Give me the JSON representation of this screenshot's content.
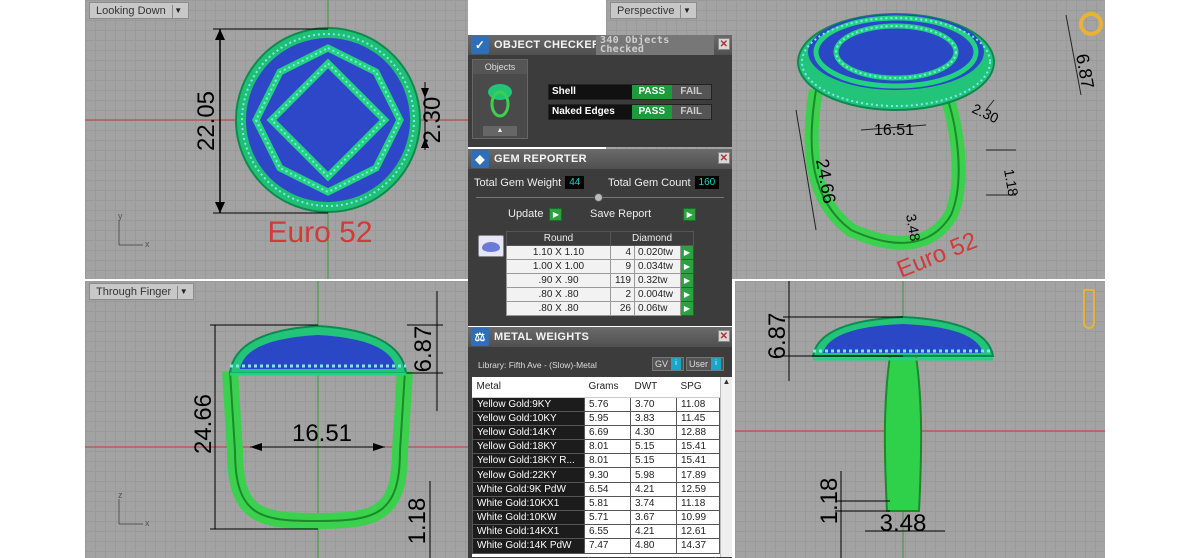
{
  "viewports": {
    "top_left": {
      "label": "Looking Down",
      "dims": [
        "22.05",
        "2.30"
      ],
      "ring_size": "Euro 52",
      "axes": [
        "y",
        "x"
      ]
    },
    "top_right": {
      "label": "Perspective",
      "dims": [
        "6.87",
        "2.30",
        "16.51",
        "24.66",
        "1.18",
        "3.48"
      ],
      "ring_size": "Euro 52"
    },
    "bottom_left": {
      "label": "Through Finger",
      "dims": [
        "6.87",
        "24.66",
        "16.51",
        "1.18"
      ],
      "axes": [
        "z",
        "x"
      ]
    },
    "bottom_right": {
      "dims": [
        "6.87",
        "1.18",
        "3.48"
      ]
    }
  },
  "object_checker": {
    "title": "OBJECT CHECKER",
    "count_text": "340 Objects Checked",
    "objects_label": "Objects",
    "checks": [
      {
        "label": "Shell",
        "pass": "PASS",
        "fail": "FAIL"
      },
      {
        "label": "Naked Edges",
        "pass": "PASS",
        "fail": "FAIL"
      }
    ]
  },
  "gem_reporter": {
    "title": "GEM REPORTER",
    "total_weight_label": "Total Gem Weight",
    "total_weight": "44",
    "total_count_label": "Total Gem Count",
    "total_count": "160",
    "update_label": "Update",
    "save_label": "Save Report",
    "headers": [
      "Round",
      "Diamond"
    ],
    "rows": [
      {
        "size": "1.10 X 1.10",
        "count": "4",
        "weight": "0.020tw"
      },
      {
        "size": "1.00 X 1.00",
        "count": "9",
        "weight": "0.034tw"
      },
      {
        "size": ".90 X .90",
        "count": "119",
        "weight": "0.32tw"
      },
      {
        "size": ".80 X .80",
        "count": "2",
        "weight": "0.004tw"
      },
      {
        "size": ".80 X .80",
        "count": "26",
        "weight": "0.06tw"
      }
    ]
  },
  "metal_weights": {
    "title": "METAL WEIGHTS",
    "library": "Library: Fifth Ave - (Slow)-Metal",
    "sel1": "GV",
    "sel2": "User",
    "headers": [
      "Metal",
      "Grams",
      "DWT",
      "SPG"
    ],
    "rows": [
      [
        "Yellow Gold:9KY",
        "5.76",
        "3.70",
        "11.08"
      ],
      [
        "Yellow Gold:10KY",
        "5.95",
        "3.83",
        "11.45"
      ],
      [
        "Yellow Gold:14KY",
        "6.69",
        "4.30",
        "12.88"
      ],
      [
        "Yellow Gold:18KY",
        "8.01",
        "5.15",
        "15.41"
      ],
      [
        "Yellow Gold:18KY R...",
        "8.01",
        "5.15",
        "15.41"
      ],
      [
        "Yellow Gold:22KY",
        "9.30",
        "5.98",
        "17.89"
      ],
      [
        "White Gold:9K PdW",
        "6.54",
        "4.21",
        "12.59"
      ],
      [
        "White Gold:10KX1",
        "5.81",
        "3.74",
        "11.18"
      ],
      [
        "White Gold:10KW",
        "5.71",
        "3.67",
        "10.99"
      ],
      [
        "White Gold:14KX1",
        "6.55",
        "4.21",
        "12.61"
      ],
      [
        "White Gold:14K PdW",
        "7.47",
        "4.80",
        "14.37"
      ]
    ]
  },
  "colors": {
    "ring_green": "#22c47a",
    "metal_green": "#3bd14f",
    "stone_blue": "#2c4fd6",
    "gem_cyan": "#7fe7f0",
    "dim_red": "#d23a3a"
  }
}
